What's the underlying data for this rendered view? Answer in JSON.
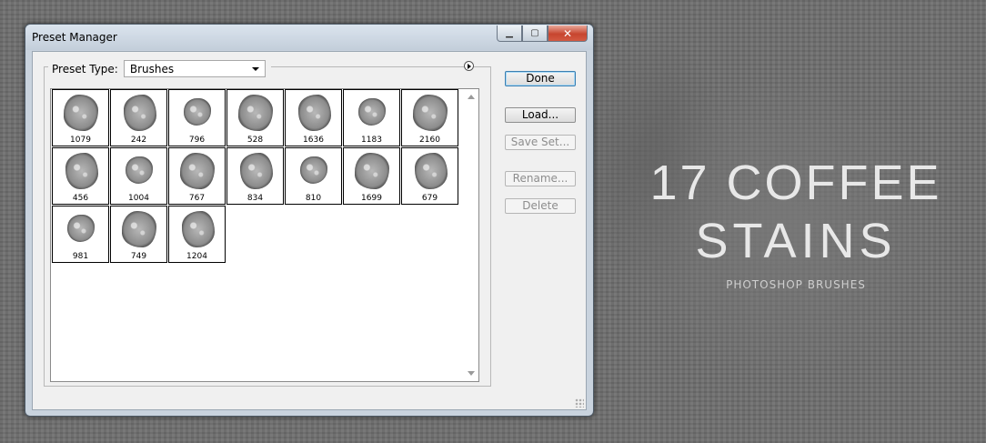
{
  "window": {
    "title": "Preset Manager",
    "close_glyph": "✕"
  },
  "preset_type": {
    "label": "Preset Type:",
    "value": "Brushes"
  },
  "buttons": {
    "done": "Done",
    "load": "Load...",
    "save_set": "Save Set...",
    "rename": "Rename...",
    "delete": "Delete"
  },
  "brushes": [
    "1079",
    "242",
    "796",
    "528",
    "1636",
    "1183",
    "2160",
    "456",
    "1004",
    "767",
    "834",
    "810",
    "1699",
    "679",
    "981",
    "749",
    "1204"
  ],
  "promo": {
    "line1": "17 COFFEE",
    "line2": "STAINS",
    "subtitle": "PHOTOSHOP BRUSHES"
  },
  "icons": [
    "minimize-icon",
    "maximize-icon",
    "close-icon",
    "chevron-down-icon",
    "flyout-menu-icon",
    "scroll-up-icon",
    "scroll-down-icon",
    "resize-grip-icon"
  ]
}
